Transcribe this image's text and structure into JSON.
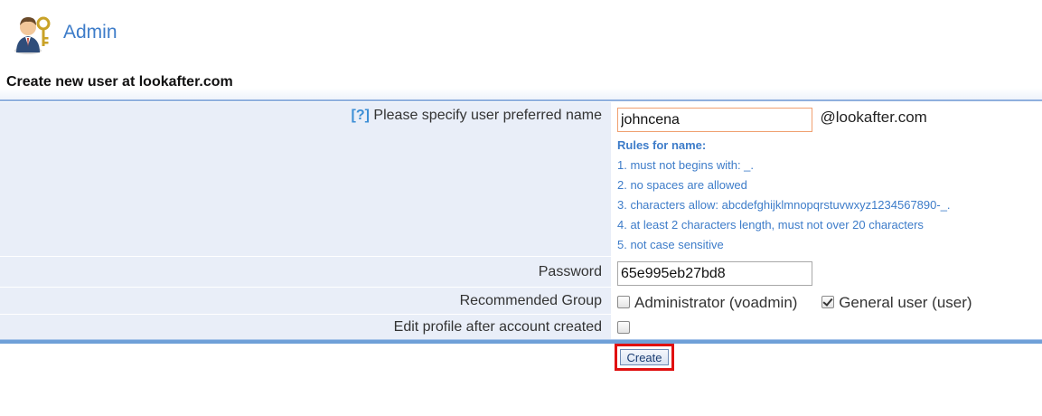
{
  "header": {
    "title": "Admin",
    "icon": "admin-user-key-icon"
  },
  "section": {
    "title": "Create new user at lookafter.com"
  },
  "form": {
    "name_row": {
      "help_link": "[?]",
      "label": "Please specify user preferred name",
      "value": "johncena",
      "domain": "@lookafter.com",
      "rules_title": "Rules for name:",
      "rules": [
        "1. must not begins with: _.",
        "2. no spaces are allowed",
        "3. characters allow: abcdefghijklmnopqrstuvwxyz1234567890-_.",
        "4. at least 2 characters length, must not over 20 characters",
        "5. not case sensitive"
      ]
    },
    "password_row": {
      "label": "Password",
      "value": "65e995eb27bd8"
    },
    "group_row": {
      "label": "Recommended Group",
      "options": [
        {
          "label": "Administrator (voadmin)",
          "checked": false
        },
        {
          "label": "General user (user)",
          "checked": true
        }
      ]
    },
    "edit_row": {
      "label": "Edit profile after account created",
      "checked": false
    },
    "submit_label": "Create"
  },
  "colors": {
    "accent": "#3d7cc9",
    "label_bg": "#e9eef8",
    "highlight_border": "#e01010"
  }
}
